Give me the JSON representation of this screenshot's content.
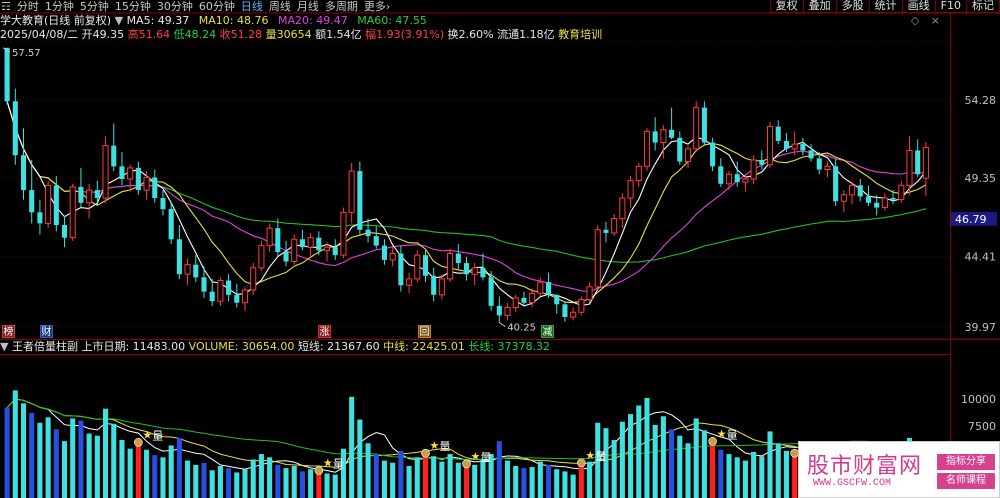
{
  "toolbar": {
    "left_tabs": [
      {
        "label": "分时",
        "active": false
      },
      {
        "label": "1分钟",
        "active": false
      },
      {
        "label": "5分钟",
        "active": false
      },
      {
        "label": "15分钟",
        "active": false
      },
      {
        "label": "30分钟",
        "active": false
      },
      {
        "label": "60分钟",
        "active": false
      },
      {
        "label": "日线",
        "active": true
      },
      {
        "label": "周线",
        "active": false
      },
      {
        "label": "月线",
        "active": false
      },
      {
        "label": "多周期",
        "active": false
      },
      {
        "label": "更多",
        "active": false
      }
    ],
    "right_tabs": [
      "复权",
      "叠加",
      "多股",
      "统计",
      "画线",
      "F10",
      "标记"
    ]
  },
  "header": {
    "stock_name": "学大教育(日线 前复权)",
    "ma5_label": "MA5: 49.37",
    "ma10_label": "MA10: 48.76",
    "ma20_label": "MA20: 49.47",
    "ma60_label": "MA60: 47.55",
    "date": "2025/04/08/二",
    "open": "开49.35",
    "high": "高51.64",
    "low": "低48.24",
    "close": "收51.28",
    "volume": "量30654",
    "amount": "额1.54亿",
    "change": "幅1.93(3.91%)",
    "turnover": "换2.60%",
    "float": "流通1.18亿",
    "industry": "教育培训"
  },
  "price_axis": {
    "labels": [
      "54.28",
      "49.35",
      "44.41",
      "39.97"
    ],
    "current": "46.79",
    "max_note": "57.57",
    "min_note": "40.25"
  },
  "volume_header": {
    "indicator": "王者倍量柱副",
    "listing": "上市日期: 11483.00",
    "volume": "VOLUME: 30654.00",
    "short": "短线: 21367.60",
    "mid": "中线: 22425.01",
    "long": "长线: 37378.32"
  },
  "volume_axis": {
    "labels": [
      "10000",
      "7500"
    ]
  },
  "event_tags": [
    {
      "text": "榜",
      "color": "#c04040"
    },
    {
      "text": "财",
      "color": "#3060c0"
    },
    {
      "text": "涨",
      "color": "#c03030"
    },
    {
      "text": "回",
      "color": "#c08020"
    },
    {
      "text": "减",
      "color": "#30a030"
    }
  ],
  "marker_label": "量",
  "watermark": {
    "title": "股市财富网",
    "url": "WWW.GSCFW.COM",
    "badge1": "指标分享",
    "badge2": "名师课程"
  },
  "colors": {
    "up": "#ff3c3c",
    "down": "#40e0e0",
    "ma5": "#ffffff",
    "ma10": "#e8e040",
    "ma20": "#e040e0",
    "ma60": "#20c020",
    "frame": "#8c0000"
  },
  "candles": [
    [
      57.57,
      57.57,
      54.0,
      54.2
    ],
    [
      54.2,
      55.0,
      50.2,
      50.8
    ],
    [
      50.8,
      52.5,
      48.0,
      48.6
    ],
    [
      48.6,
      50.5,
      46.5,
      47.2
    ],
    [
      47.2,
      48.0,
      45.8,
      46.5
    ],
    [
      46.5,
      49.2,
      46.2,
      48.9
    ],
    [
      48.9,
      49.5,
      46.0,
      46.4
    ],
    [
      46.4,
      47.0,
      45.0,
      45.6
    ],
    [
      45.6,
      49.0,
      45.4,
      48.8
    ],
    [
      48.8,
      50.0,
      47.5,
      47.8
    ],
    [
      47.8,
      49.0,
      46.8,
      48.6
    ],
    [
      48.6,
      49.2,
      47.6,
      48.1
    ],
    [
      48.1,
      52.0,
      47.8,
      51.4
    ],
    [
      51.4,
      52.8,
      49.8,
      50.1
    ],
    [
      50.1,
      51.0,
      48.9,
      49.3
    ],
    [
      49.3,
      50.2,
      48.5,
      50.0
    ],
    [
      50.0,
      50.4,
      48.3,
      48.6
    ],
    [
      48.6,
      49.8,
      48.0,
      49.4
    ],
    [
      49.4,
      49.9,
      47.8,
      48.1
    ],
    [
      48.1,
      48.6,
      47.0,
      47.4
    ],
    [
      47.4,
      47.8,
      45.2,
      45.5
    ],
    [
      45.5,
      46.4,
      43.0,
      43.3
    ],
    [
      43.3,
      44.3,
      42.6,
      43.9
    ],
    [
      43.9,
      44.5,
      42.8,
      43.1
    ],
    [
      43.1,
      43.8,
      41.8,
      42.2
    ],
    [
      42.2,
      43.0,
      41.3,
      41.6
    ],
    [
      41.6,
      43.1,
      41.3,
      42.9
    ],
    [
      42.9,
      43.3,
      41.6,
      42.0
    ],
    [
      42.0,
      42.7,
      41.2,
      41.5
    ],
    [
      41.5,
      42.5,
      41.0,
      42.3
    ],
    [
      42.3,
      44.0,
      42.0,
      43.7
    ],
    [
      43.7,
      45.4,
      43.5,
      45.1
    ],
    [
      45.1,
      46.5,
      44.7,
      46.2
    ],
    [
      46.2,
      46.8,
      44.4,
      44.7
    ],
    [
      44.7,
      45.4,
      43.8,
      44.1
    ],
    [
      44.1,
      45.8,
      43.9,
      45.5
    ],
    [
      45.5,
      46.1,
      44.8,
      45.0
    ],
    [
      45.0,
      45.9,
      44.4,
      45.6
    ],
    [
      45.6,
      46.0,
      44.5,
      44.8
    ],
    [
      44.8,
      45.3,
      44.1,
      45.0
    ],
    [
      45.0,
      45.5,
      44.2,
      44.5
    ],
    [
      44.5,
      47.5,
      44.3,
      47.2
    ],
    [
      47.2,
      50.3,
      46.5,
      49.8
    ],
    [
      49.8,
      50.4,
      45.8,
      46.1
    ],
    [
      46.1,
      46.8,
      45.3,
      45.7
    ],
    [
      45.7,
      46.3,
      44.9,
      45.1
    ],
    [
      45.1,
      45.5,
      43.9,
      44.2
    ],
    [
      44.2,
      45.0,
      43.8,
      44.6
    ],
    [
      44.6,
      45.1,
      42.2,
      42.6
    ],
    [
      42.6,
      43.4,
      42.1,
      43.0
    ],
    [
      43.0,
      44.8,
      42.8,
      44.5
    ],
    [
      44.5,
      44.9,
      42.8,
      43.2
    ],
    [
      43.2,
      43.7,
      41.6,
      42.0
    ],
    [
      42.0,
      43.3,
      41.7,
      43.0
    ],
    [
      43.0,
      44.9,
      42.8,
      44.6
    ],
    [
      44.6,
      45.2,
      43.6,
      44.0
    ],
    [
      44.0,
      44.4,
      42.9,
      43.3
    ],
    [
      43.3,
      44.0,
      42.6,
      43.7
    ],
    [
      43.7,
      44.6,
      42.9,
      43.1
    ],
    [
      43.1,
      43.5,
      41.0,
      41.3
    ],
    [
      41.3,
      41.9,
      40.25,
      40.7
    ],
    [
      40.7,
      41.5,
      40.4,
      41.2
    ],
    [
      41.2,
      42.0,
      40.9,
      41.8
    ],
    [
      41.8,
      42.2,
      41.3,
      41.5
    ],
    [
      41.5,
      42.4,
      41.2,
      42.1
    ],
    [
      42.1,
      43.1,
      41.9,
      42.8
    ],
    [
      42.8,
      43.4,
      41.8,
      42.0
    ],
    [
      42.0,
      41.9,
      40.8,
      41.4
    ],
    [
      41.4,
      41.6,
      40.3,
      40.6
    ],
    [
      40.6,
      41.2,
      40.4,
      40.9
    ],
    [
      40.9,
      41.9,
      40.7,
      41.7
    ],
    [
      41.7,
      42.8,
      41.5,
      42.5
    ],
    [
      42.5,
      46.4,
      42.3,
      46.1
    ],
    [
      46.1,
      46.6,
      45.3,
      45.9
    ],
    [
      45.9,
      47.1,
      45.7,
      46.8
    ],
    [
      46.8,
      48.4,
      46.2,
      48.1
    ],
    [
      48.1,
      49.5,
      47.5,
      49.2
    ],
    [
      49.2,
      50.3,
      48.8,
      50.1
    ],
    [
      50.1,
      52.5,
      49.8,
      52.3
    ],
    [
      52.3,
      53.2,
      51.1,
      51.6
    ],
    [
      51.6,
      52.7,
      50.6,
      52.4
    ],
    [
      52.4,
      53.8,
      51.8,
      51.9
    ],
    [
      51.9,
      52.3,
      50.2,
      50.4
    ],
    [
      50.4,
      51.4,
      50.0,
      51.2
    ],
    [
      51.2,
      54.2,
      51.0,
      53.8
    ],
    [
      53.8,
      54.2,
      51.4,
      51.6
    ],
    [
      51.6,
      51.9,
      49.8,
      50.1
    ],
    [
      50.1,
      50.6,
      48.8,
      49.0
    ],
    [
      49.0,
      49.8,
      48.6,
      49.6
    ],
    [
      49.6,
      50.4,
      48.8,
      49.1
    ],
    [
      49.1,
      49.6,
      48.5,
      49.3
    ],
    [
      49.3,
      50.8,
      49.0,
      50.5
    ],
    [
      50.5,
      51.1,
      49.9,
      50.2
    ],
    [
      50.2,
      52.9,
      50.0,
      52.6
    ],
    [
      52.6,
      53.0,
      51.5,
      51.7
    ],
    [
      51.7,
      52.2,
      51.0,
      51.2
    ],
    [
      51.2,
      52.3,
      50.8,
      51.5
    ],
    [
      51.5,
      51.9,
      50.8,
      51.1
    ],
    [
      51.1,
      51.5,
      50.4,
      50.6
    ],
    [
      50.6,
      51.0,
      49.6,
      49.9
    ],
    [
      49.9,
      50.4,
      49.4,
      50.1
    ],
    [
      50.1,
      50.6,
      47.6,
      47.9
    ],
    [
      47.9,
      48.6,
      47.2,
      48.3
    ],
    [
      48.3,
      49.1,
      47.7,
      48.9
    ],
    [
      48.9,
      49.3,
      47.9,
      48.2
    ],
    [
      48.2,
      48.9,
      47.6,
      47.8
    ],
    [
      47.8,
      48.3,
      47.0,
      47.5
    ],
    [
      47.5,
      48.4,
      47.3,
      48.1
    ],
    [
      48.1,
      48.6,
      47.7,
      48.0
    ],
    [
      48.0,
      49.2,
      47.8,
      48.9
    ],
    [
      48.9,
      52.0,
      48.3,
      51.1
    ],
    [
      51.1,
      51.8,
      49.4,
      49.6
    ],
    [
      49.35,
      51.64,
      48.24,
      51.28
    ]
  ],
  "volumes": [
    9200,
    10800,
    9600,
    8700,
    7800,
    8300,
    7200,
    6100,
    8200,
    8000,
    6800,
    6600,
    9100,
    7700,
    6200,
    5400,
    5800,
    5300,
    4800,
    4600,
    5700,
    6400,
    4300,
    3900,
    4100,
    3400,
    3800,
    3600,
    3200,
    3500,
    4400,
    4900,
    4600,
    3900,
    3600,
    3800,
    3300,
    3500,
    3200,
    3100,
    3000,
    5400,
    10200,
    8100,
    5900,
    4900,
    4300,
    4100,
    5200,
    3800,
    4600,
    4800,
    4700,
    4200,
    4900,
    4100,
    3800,
    3900,
    4400,
    4900,
    6100,
    4300,
    3800,
    3600,
    3700,
    4200,
    3900,
    3500,
    3300,
    3000,
    3900,
    4200,
    7800,
    7300,
    6200,
    7900,
    8600,
    9400,
    10100,
    7600,
    8400,
    7200,
    6600,
    5900,
    8200,
    7100,
    5900,
    5300,
    4900,
    4600,
    4300,
    5100,
    4700,
    7000,
    5900,
    5200,
    4800,
    4600,
    4300,
    4500,
    4100,
    5600,
    4700,
    4800,
    4000,
    3800,
    3600,
    4000,
    3900,
    4400,
    6400,
    5600,
    4600
  ],
  "markers": [
    16,
    38,
    51,
    56,
    70,
    86,
    96
  ]
}
